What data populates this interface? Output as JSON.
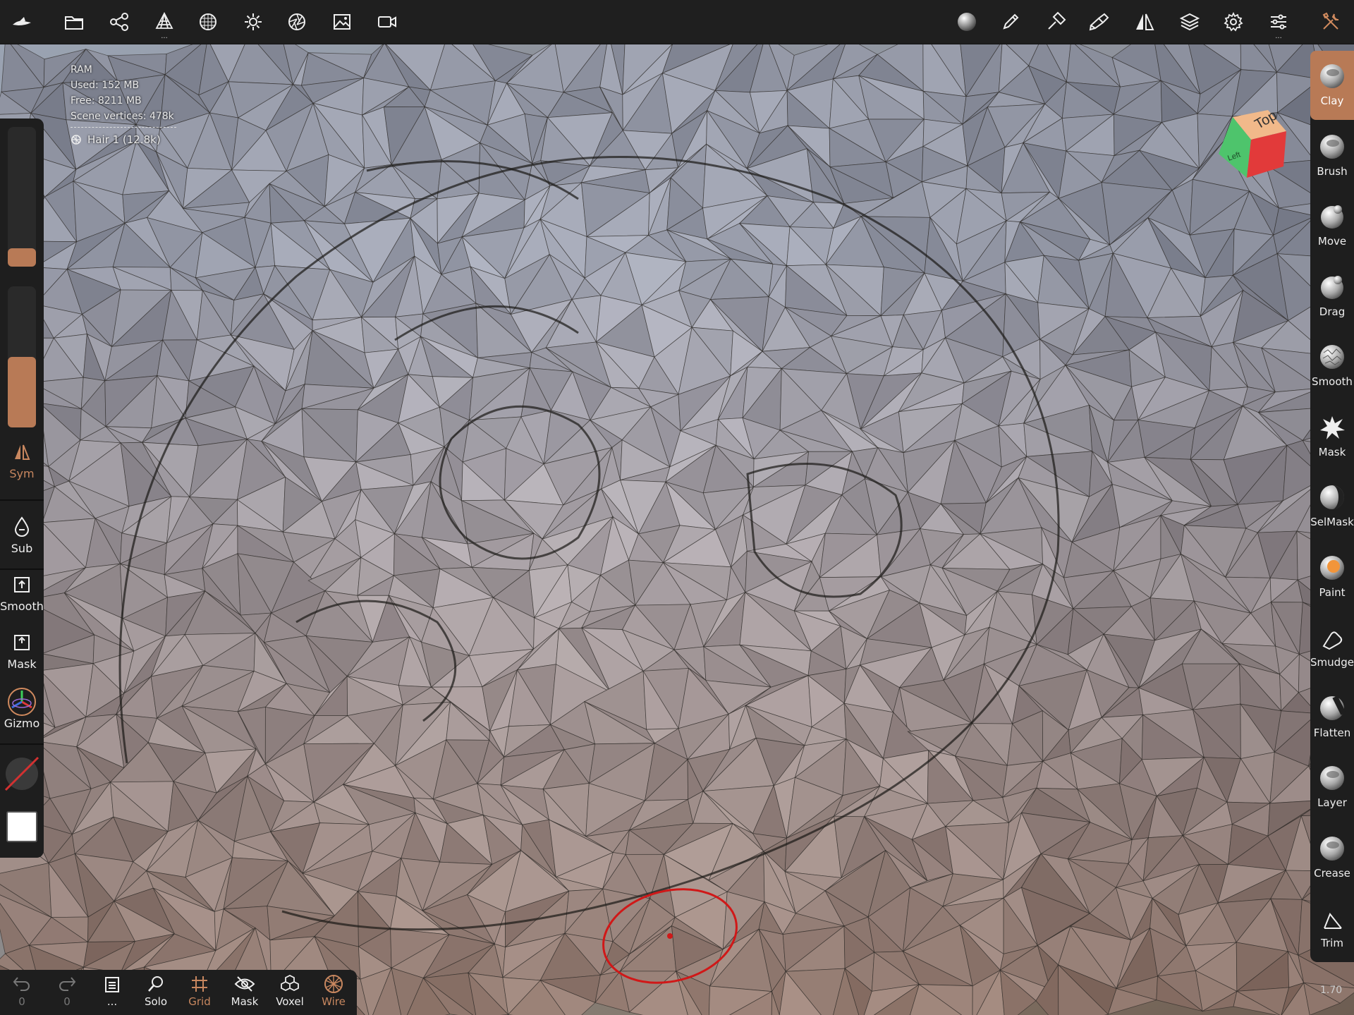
{
  "stats": {
    "ram_label": "RAM",
    "used": "Used: 152 MB",
    "free": "Free: 8211 MB",
    "scene_vertices": "Scene vertices: 478k",
    "object_label": "Hair 1 (12.8k)"
  },
  "viewcube": {
    "top_label": "Top",
    "left_label": "Left"
  },
  "left_panel": {
    "sym_label": "Sym",
    "sub_label": "Sub",
    "smooth_label": "Smooth",
    "mask_label": "Mask",
    "gizmo_label": "Gizmo"
  },
  "tools": [
    {
      "label": "Clay",
      "icon": "clay-sphere-icon"
    },
    {
      "label": "Brush",
      "icon": "brush-sphere-icon"
    },
    {
      "label": "Move",
      "icon": "move-sphere-icon"
    },
    {
      "label": "Drag",
      "icon": "drag-sphere-icon"
    },
    {
      "label": "Smooth",
      "icon": "smooth-sphere-icon"
    },
    {
      "label": "Mask",
      "icon": "mask-splat-icon"
    },
    {
      "label": "SelMask",
      "icon": "selmask-sphere-icon"
    },
    {
      "label": "Paint",
      "icon": "paint-sphere-icon"
    },
    {
      "label": "Smudge",
      "icon": "smudge-finger-icon"
    },
    {
      "label": "Flatten",
      "icon": "flatten-sphere-icon"
    },
    {
      "label": "Layer",
      "icon": "layer-sphere-icon"
    },
    {
      "label": "Crease",
      "icon": "crease-sphere-icon"
    },
    {
      "label": "Trim",
      "icon": "trim-icon"
    }
  ],
  "bottom_bar": {
    "undo_count": "0",
    "redo_count": "0",
    "more_label": "...",
    "solo_label": "Solo",
    "grid_label": "Grid",
    "mask_label": "Mask",
    "voxel_label": "Voxel",
    "wire_label": "Wire"
  },
  "version": "1.70",
  "colors": {
    "accent": "#b87a56",
    "panel": "#1e1e1e",
    "cursor": "#d01818"
  }
}
